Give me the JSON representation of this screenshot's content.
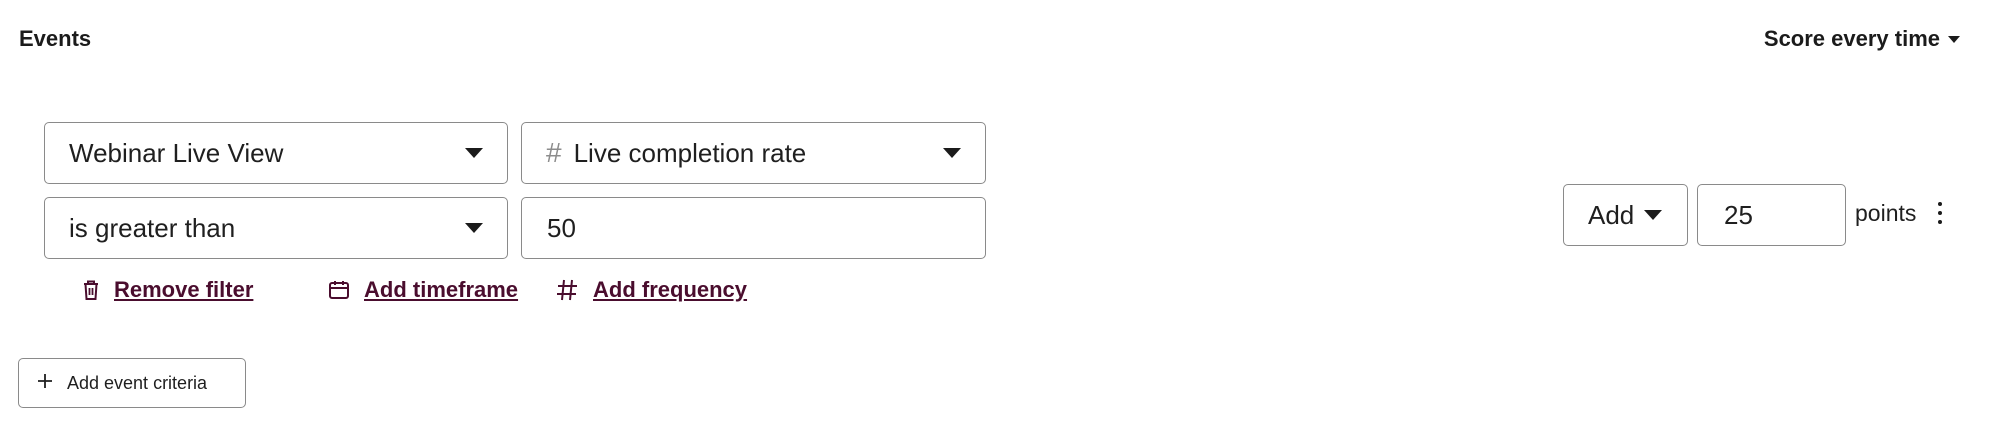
{
  "header": {
    "title": "Events",
    "score_mode_label": "Score every time"
  },
  "criteria": {
    "event_select": {
      "value": "Webinar Live View"
    },
    "property_select": {
      "prefix_icon": "hash-icon",
      "value": "Live completion rate"
    },
    "operator_select": {
      "value": "is greater than"
    },
    "value_input": {
      "value": "50"
    }
  },
  "actions": {
    "remove_filter": "Remove filter",
    "add_timeframe": "Add timeframe",
    "add_frequency": "Add frequency"
  },
  "scoring": {
    "operation_label": "Add",
    "points_value": "25",
    "points_label": "points"
  },
  "footer": {
    "add_event_criteria": "Add event criteria"
  },
  "colors": {
    "link": "#4a0d2e",
    "border": "#8a8a8a",
    "text": "#1f1f1f"
  }
}
